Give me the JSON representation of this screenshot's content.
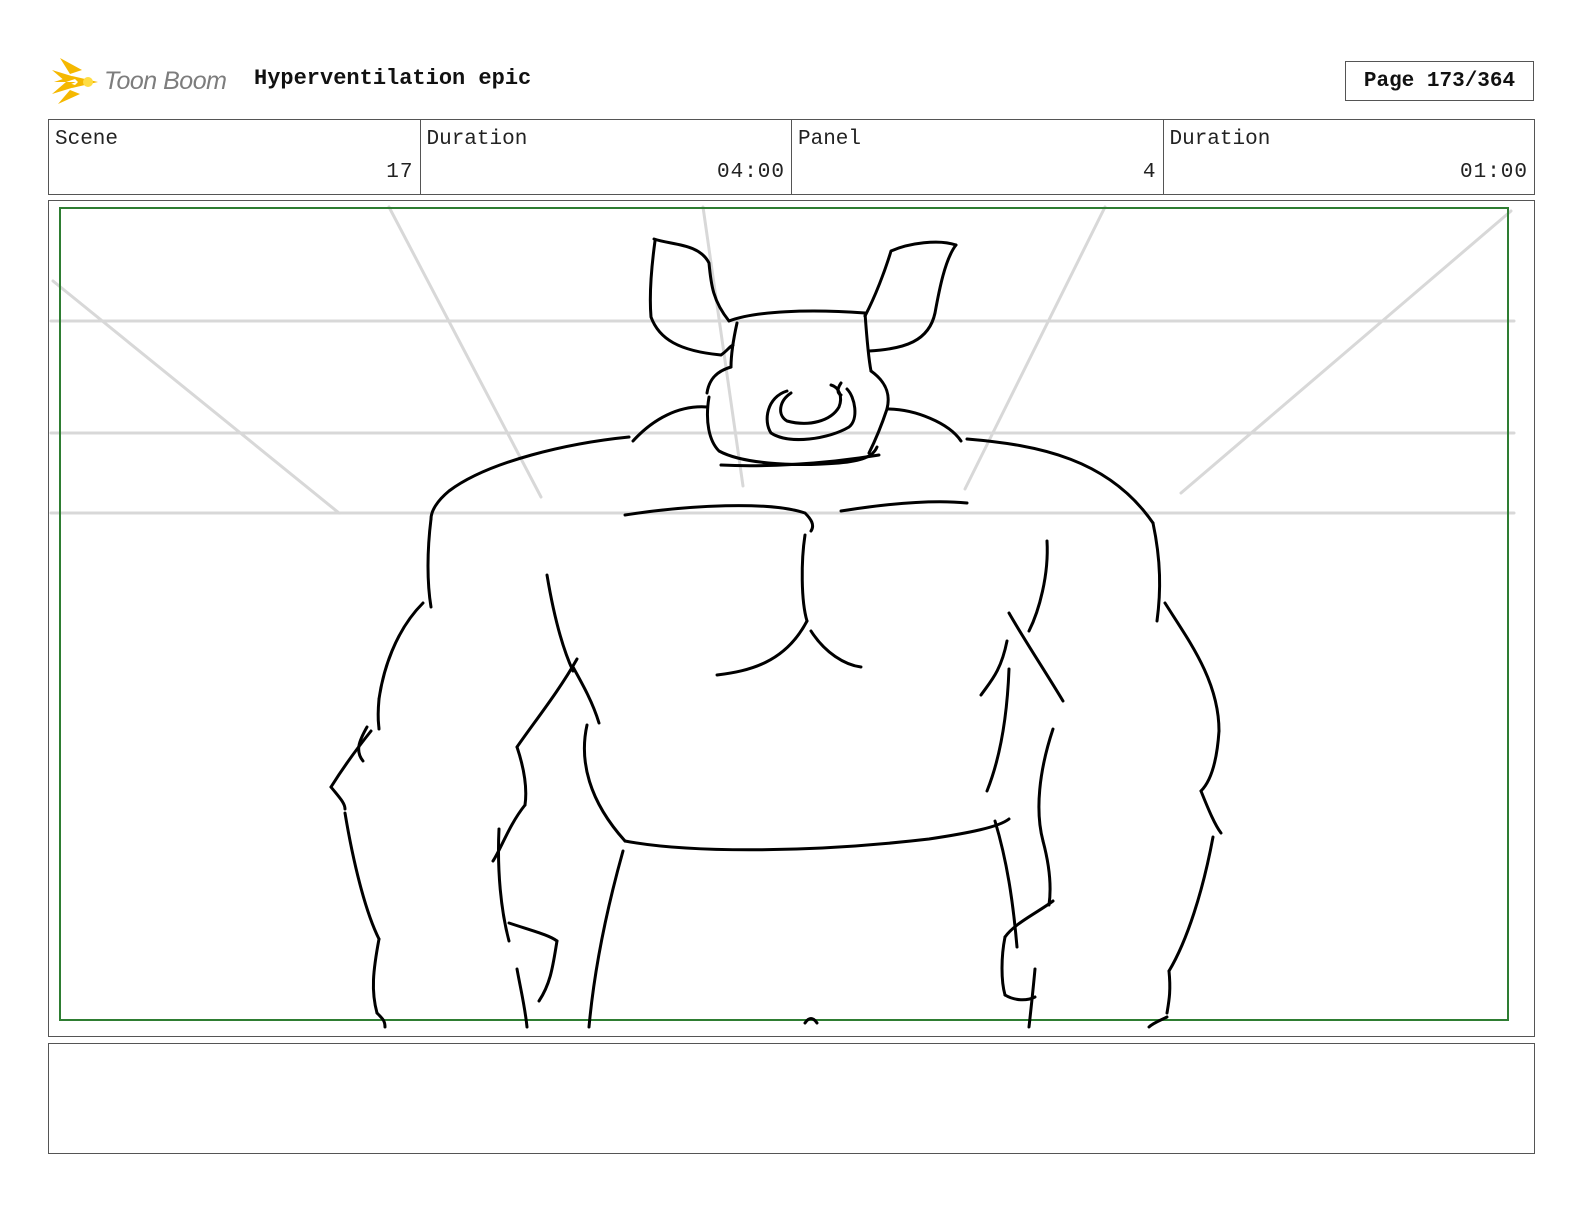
{
  "header": {
    "logo_text": "Toon Boom",
    "project_title": "Hyperventilation epic",
    "page_label": "Page 173/364"
  },
  "info": [
    {
      "label": "Scene",
      "value": "17"
    },
    {
      "label": "Duration",
      "value": "04:00"
    },
    {
      "label": "Panel",
      "value": "4"
    },
    {
      "label": "Duration",
      "value": "01:00"
    }
  ],
  "panel": {
    "safe_frame_color": "#2e7d32",
    "sketch_stroke_color": "#000000",
    "guide_color": "#d8d8d8"
  },
  "logo": {
    "icon": "starburst-icon",
    "accent_color": "#f5b800"
  },
  "notes": {
    "text": ""
  }
}
